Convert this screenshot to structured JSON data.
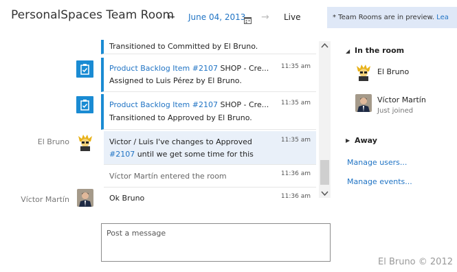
{
  "header": {
    "room_title": "PersonalSpaces Team Room",
    "date": "June 04, 2013",
    "live_label": "Live",
    "preview_text": "* Team Rooms are in preview.",
    "preview_link": "Lea"
  },
  "messages": [
    {
      "line1": "Transitioned to Committed by El Bruno."
    },
    {
      "link": "Product Backlog Item #2107",
      "title_rest": " SHOP - Cre...",
      "time": "11:35 am",
      "line2": "Assigned to Luis Pérez by El Bruno."
    },
    {
      "link": "Product Backlog Item #2107",
      "title_rest": " SHOP - Cre...",
      "time": "11:35 am",
      "line2": "Transitioned to Approved by El Bruno."
    },
    {
      "sender": "El Bruno",
      "line1": "Victor / Luis I've changes to Approved",
      "link": "#2107",
      "line2_rest": " until we get some time for this",
      "time": "11:35 am"
    },
    {
      "text": "Víctor Martín entered the room",
      "time": "11:36 am"
    },
    {
      "sender": "Víctor Martín",
      "text": "Ok Bruno",
      "time": "11:36 am"
    }
  ],
  "composer": {
    "placeholder": "Post a message"
  },
  "sidebar": {
    "in_room_heading": "In the room",
    "members": [
      {
        "name": "El Bruno",
        "status": ""
      },
      {
        "name": "Víctor Martín",
        "status": "Just joined"
      }
    ],
    "away_heading": "Away",
    "manage_users": "Manage users...",
    "manage_events": "Manage events..."
  },
  "footer": {
    "copyright": "El Bruno © 2012"
  },
  "colors": {
    "accent": "#1a8bd3",
    "link": "#1f73c4",
    "highlight": "#e9f0f9",
    "banner": "#dfe8f7"
  }
}
